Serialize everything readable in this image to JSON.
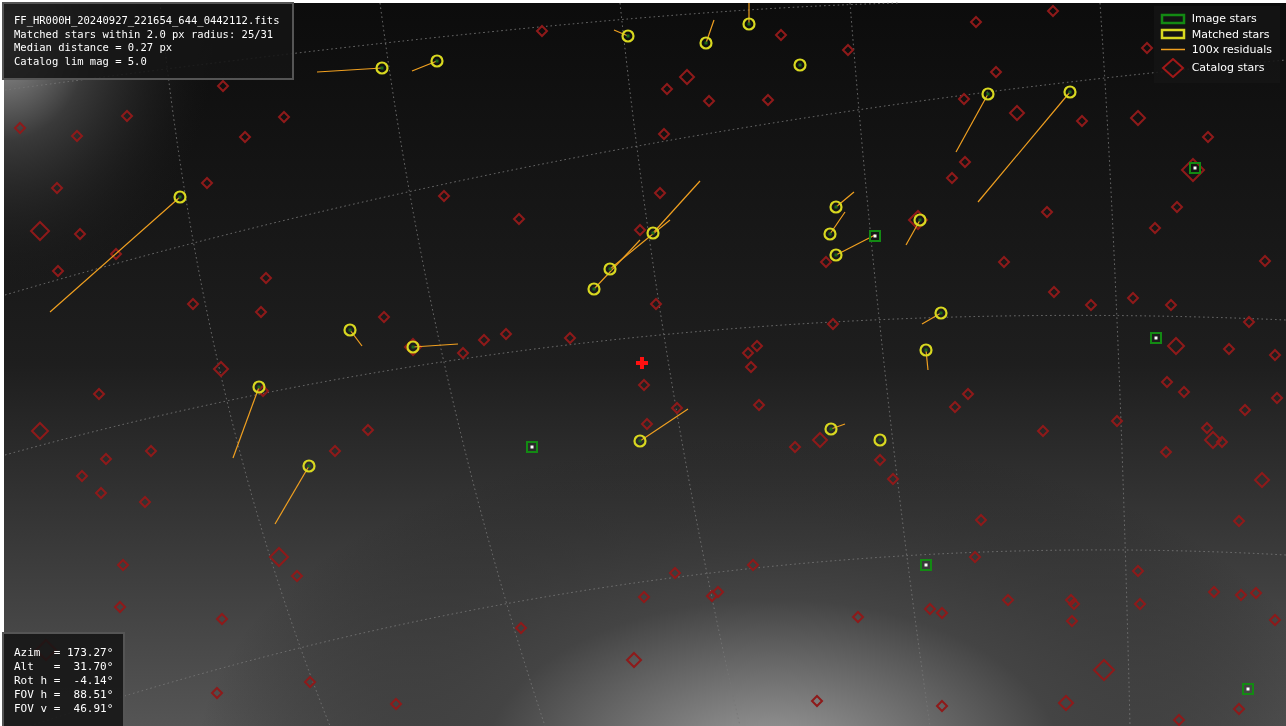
{
  "info_box": {
    "lines": [
      "FF_HR000H_20240927_221654_644_0442112.fits",
      "Matched stars within 2.0 px radius: 25/31",
      "Median distance = 0.27 px",
      "Catalog lim mag = 5.0"
    ]
  },
  "legend": {
    "items": [
      {
        "kind": "image",
        "label": "Image stars"
      },
      {
        "kind": "matched",
        "label": "Matched stars"
      },
      {
        "kind": "residual",
        "label": "100x residuals"
      },
      {
        "kind": "catalog",
        "label": "Catalog stars"
      }
    ]
  },
  "pointing_box": {
    "lines": [
      "Azim  = 173.27°",
      "Alt   =  31.70°",
      "Rot h =  -4.14°",
      "FOV h =  88.51°",
      "FOV v =  46.91°"
    ]
  }
}
